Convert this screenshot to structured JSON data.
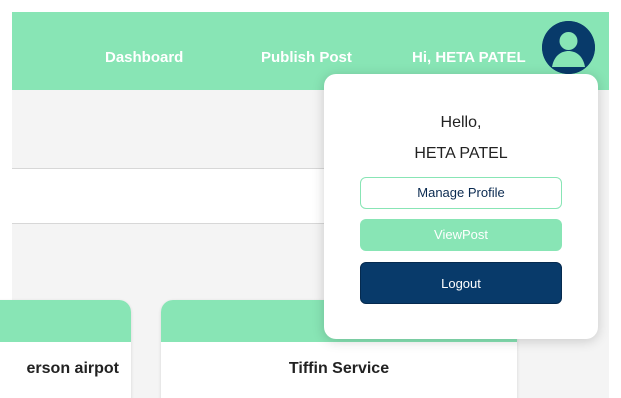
{
  "navbar": {
    "links": {
      "dashboard": "Dashboard",
      "publish_post": "Publish Post",
      "greeting": "Hi, HETA PATEL"
    },
    "avatar_icon": "user-circle-icon"
  },
  "cards": [
    {
      "title": "erson airpot"
    },
    {
      "title": "Tiffin Service"
    }
  ],
  "profile_menu": {
    "hello": "Hello,",
    "name": "HETA PATEL",
    "buttons": {
      "manage_profile": "Manage Profile",
      "view_post": "ViewPost",
      "logout": "Logout"
    }
  },
  "colors": {
    "accent": "#88e5b5",
    "dark": "#083a6a",
    "background": "#f4f4f4"
  }
}
